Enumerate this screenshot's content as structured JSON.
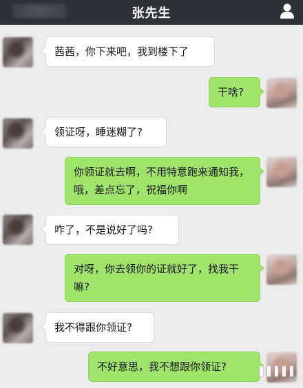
{
  "header": {
    "title": "张先生",
    "profile_icon": "person-icon",
    "back_area": "blurred"
  },
  "messages": [
    {
      "side": "in",
      "text": "茜茜，你下来吧，我到楼下了"
    },
    {
      "side": "out",
      "text": "干啥?"
    },
    {
      "side": "in",
      "text": "领证呀，睡迷糊了?"
    },
    {
      "side": "out",
      "text": "你领证就去啊，不用特意跑来通知我，哦，差点忘了，祝福你啊"
    },
    {
      "side": "in",
      "text": "咋了，不是说好了吗?"
    },
    {
      "side": "out",
      "text": "对呀，你去领你的证就好了，找我干嘛?"
    },
    {
      "side": "in",
      "text": "我不得跟你领证?"
    },
    {
      "side": "out",
      "text": "不好意思，我不想跟你领证?"
    }
  ],
  "colors": {
    "header_bg": "#2f3237",
    "chat_bg": "#ececec",
    "incoming_bubble": "#ffffff",
    "outgoing_bubble": "#9fe46b"
  }
}
